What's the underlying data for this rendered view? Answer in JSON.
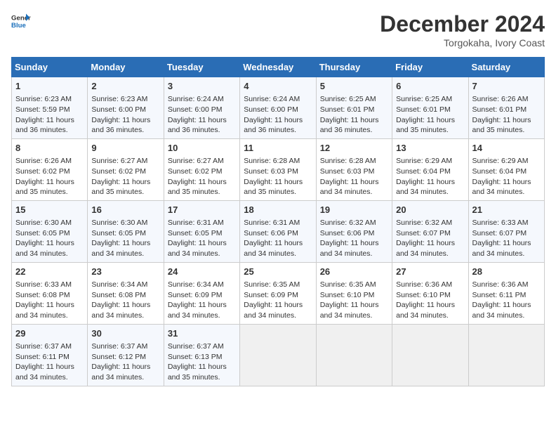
{
  "logo": {
    "line1": "General",
    "line2": "Blue"
  },
  "title": "December 2024",
  "subtitle": "Torgokaha, Ivory Coast",
  "days_header": [
    "Sunday",
    "Monday",
    "Tuesday",
    "Wednesday",
    "Thursday",
    "Friday",
    "Saturday"
  ],
  "weeks": [
    [
      {
        "day": "1",
        "lines": [
          "Sunrise: 6:23 AM",
          "Sunset: 5:59 PM",
          "Daylight: 11 hours",
          "and 36 minutes."
        ]
      },
      {
        "day": "2",
        "lines": [
          "Sunrise: 6:23 AM",
          "Sunset: 6:00 PM",
          "Daylight: 11 hours",
          "and 36 minutes."
        ]
      },
      {
        "day": "3",
        "lines": [
          "Sunrise: 6:24 AM",
          "Sunset: 6:00 PM",
          "Daylight: 11 hours",
          "and 36 minutes."
        ]
      },
      {
        "day": "4",
        "lines": [
          "Sunrise: 6:24 AM",
          "Sunset: 6:00 PM",
          "Daylight: 11 hours",
          "and 36 minutes."
        ]
      },
      {
        "day": "5",
        "lines": [
          "Sunrise: 6:25 AM",
          "Sunset: 6:01 PM",
          "Daylight: 11 hours",
          "and 36 minutes."
        ]
      },
      {
        "day": "6",
        "lines": [
          "Sunrise: 6:25 AM",
          "Sunset: 6:01 PM",
          "Daylight: 11 hours",
          "and 35 minutes."
        ]
      },
      {
        "day": "7",
        "lines": [
          "Sunrise: 6:26 AM",
          "Sunset: 6:01 PM",
          "Daylight: 11 hours",
          "and 35 minutes."
        ]
      }
    ],
    [
      {
        "day": "8",
        "lines": [
          "Sunrise: 6:26 AM",
          "Sunset: 6:02 PM",
          "Daylight: 11 hours",
          "and 35 minutes."
        ]
      },
      {
        "day": "9",
        "lines": [
          "Sunrise: 6:27 AM",
          "Sunset: 6:02 PM",
          "Daylight: 11 hours",
          "and 35 minutes."
        ]
      },
      {
        "day": "10",
        "lines": [
          "Sunrise: 6:27 AM",
          "Sunset: 6:02 PM",
          "Daylight: 11 hours",
          "and 35 minutes."
        ]
      },
      {
        "day": "11",
        "lines": [
          "Sunrise: 6:28 AM",
          "Sunset: 6:03 PM",
          "Daylight: 11 hours",
          "and 35 minutes."
        ]
      },
      {
        "day": "12",
        "lines": [
          "Sunrise: 6:28 AM",
          "Sunset: 6:03 PM",
          "Daylight: 11 hours",
          "and 34 minutes."
        ]
      },
      {
        "day": "13",
        "lines": [
          "Sunrise: 6:29 AM",
          "Sunset: 6:04 PM",
          "Daylight: 11 hours",
          "and 34 minutes."
        ]
      },
      {
        "day": "14",
        "lines": [
          "Sunrise: 6:29 AM",
          "Sunset: 6:04 PM",
          "Daylight: 11 hours",
          "and 34 minutes."
        ]
      }
    ],
    [
      {
        "day": "15",
        "lines": [
          "Sunrise: 6:30 AM",
          "Sunset: 6:05 PM",
          "Daylight: 11 hours",
          "and 34 minutes."
        ]
      },
      {
        "day": "16",
        "lines": [
          "Sunrise: 6:30 AM",
          "Sunset: 6:05 PM",
          "Daylight: 11 hours",
          "and 34 minutes."
        ]
      },
      {
        "day": "17",
        "lines": [
          "Sunrise: 6:31 AM",
          "Sunset: 6:05 PM",
          "Daylight: 11 hours",
          "and 34 minutes."
        ]
      },
      {
        "day": "18",
        "lines": [
          "Sunrise: 6:31 AM",
          "Sunset: 6:06 PM",
          "Daylight: 11 hours",
          "and 34 minutes."
        ]
      },
      {
        "day": "19",
        "lines": [
          "Sunrise: 6:32 AM",
          "Sunset: 6:06 PM",
          "Daylight: 11 hours",
          "and 34 minutes."
        ]
      },
      {
        "day": "20",
        "lines": [
          "Sunrise: 6:32 AM",
          "Sunset: 6:07 PM",
          "Daylight: 11 hours",
          "and 34 minutes."
        ]
      },
      {
        "day": "21",
        "lines": [
          "Sunrise: 6:33 AM",
          "Sunset: 6:07 PM",
          "Daylight: 11 hours",
          "and 34 minutes."
        ]
      }
    ],
    [
      {
        "day": "22",
        "lines": [
          "Sunrise: 6:33 AM",
          "Sunset: 6:08 PM",
          "Daylight: 11 hours",
          "and 34 minutes."
        ]
      },
      {
        "day": "23",
        "lines": [
          "Sunrise: 6:34 AM",
          "Sunset: 6:08 PM",
          "Daylight: 11 hours",
          "and 34 minutes."
        ]
      },
      {
        "day": "24",
        "lines": [
          "Sunrise: 6:34 AM",
          "Sunset: 6:09 PM",
          "Daylight: 11 hours",
          "and 34 minutes."
        ]
      },
      {
        "day": "25",
        "lines": [
          "Sunrise: 6:35 AM",
          "Sunset: 6:09 PM",
          "Daylight: 11 hours",
          "and 34 minutes."
        ]
      },
      {
        "day": "26",
        "lines": [
          "Sunrise: 6:35 AM",
          "Sunset: 6:10 PM",
          "Daylight: 11 hours",
          "and 34 minutes."
        ]
      },
      {
        "day": "27",
        "lines": [
          "Sunrise: 6:36 AM",
          "Sunset: 6:10 PM",
          "Daylight: 11 hours",
          "and 34 minutes."
        ]
      },
      {
        "day": "28",
        "lines": [
          "Sunrise: 6:36 AM",
          "Sunset: 6:11 PM",
          "Daylight: 11 hours",
          "and 34 minutes."
        ]
      }
    ],
    [
      {
        "day": "29",
        "lines": [
          "Sunrise: 6:37 AM",
          "Sunset: 6:11 PM",
          "Daylight: 11 hours",
          "and 34 minutes."
        ]
      },
      {
        "day": "30",
        "lines": [
          "Sunrise: 6:37 AM",
          "Sunset: 6:12 PM",
          "Daylight: 11 hours",
          "and 34 minutes."
        ]
      },
      {
        "day": "31",
        "lines": [
          "Sunrise: 6:37 AM",
          "Sunset: 6:13 PM",
          "Daylight: 11 hours",
          "and 35 minutes."
        ]
      },
      null,
      null,
      null,
      null
    ]
  ]
}
